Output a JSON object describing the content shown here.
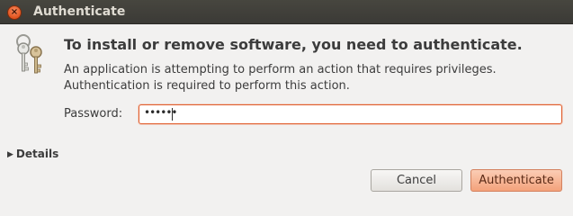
{
  "window": {
    "title": "Authenticate",
    "close_symbol": "×"
  },
  "dialog": {
    "icon": "keys-icon",
    "heading": "To install or remove software, you need to authenticate.",
    "description_line1": "An application is attempting to perform an action that requires privileges.",
    "description_line2": "Authentication is required to perform this action.",
    "password_label": "Password:",
    "password_value": "••••••",
    "details_label": "Details",
    "details_arrow": "▶"
  },
  "buttons": {
    "cancel": "Cancel",
    "authenticate": "Authenticate"
  },
  "colors": {
    "titlebar": "#3b3a36",
    "close_button": "#e2541f",
    "field_focus_border": "#e05e2e",
    "default_button": "#f3a27b"
  }
}
